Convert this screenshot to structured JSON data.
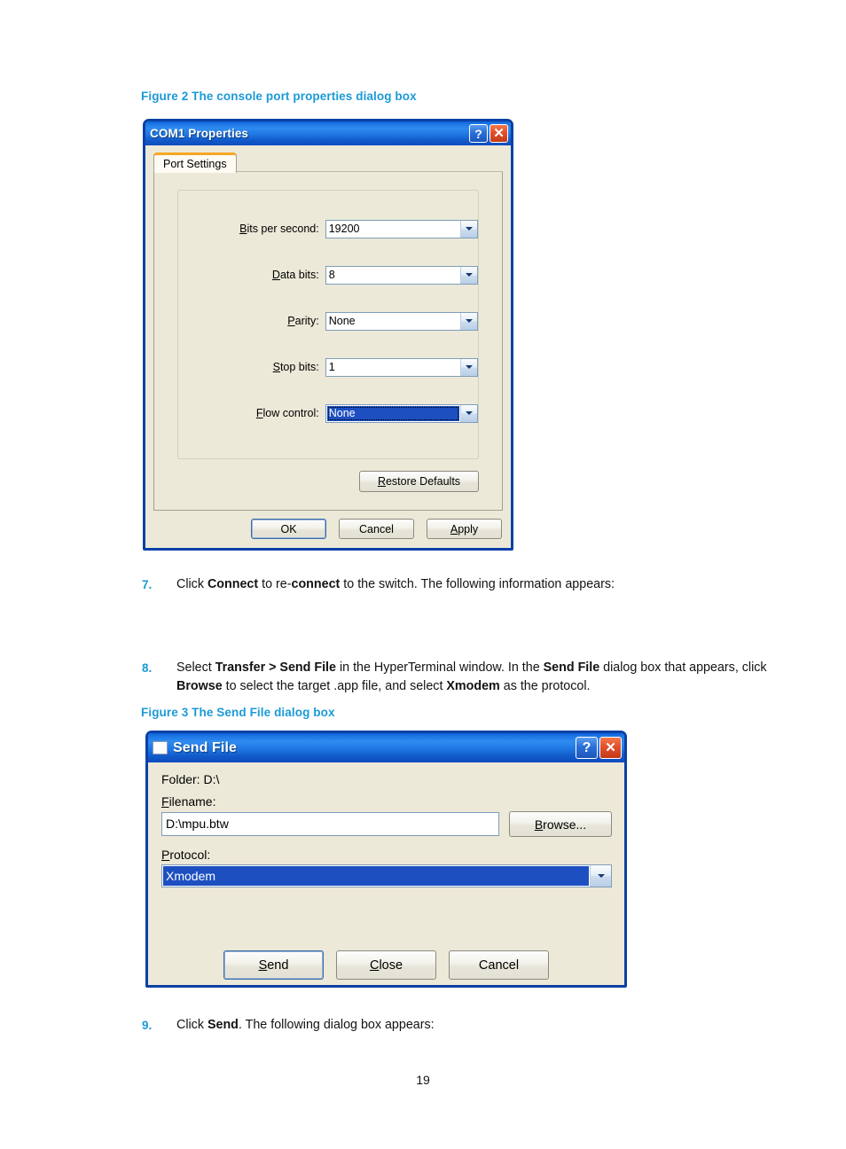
{
  "figure2": {
    "caption": "Figure 2 The console port properties dialog box",
    "dialog": {
      "title": "COM1 Properties",
      "help_button": "?",
      "close_button": "✕",
      "tab": "Port Settings",
      "fields": [
        {
          "label_pre": "B",
          "label_accel": "B",
          "label": "Bits per second:",
          "value": "19200"
        },
        {
          "label": "Data bits:",
          "value": "8"
        },
        {
          "label": "Parity:",
          "value": "None"
        },
        {
          "label": "Stop bits:",
          "value": "1"
        },
        {
          "label": "Flow control:",
          "value": "None"
        }
      ],
      "restore_defaults": "Restore Defaults",
      "ok": "OK",
      "cancel": "Cancel",
      "apply": "Apply"
    }
  },
  "step7": {
    "number": "7.",
    "text": "Click Connect to re-connect to the switch. The following information appears:"
  },
  "step8": {
    "number": "8.",
    "line1": "Select Transfer > Send File in the HyperTerminal window. In the Send File dialog box that appears,",
    "line2": "click Browse to select the target .app file, and select Xmodem as the protocol."
  },
  "figure3": {
    "caption": "Figure 3 The Send File dialog box",
    "dialog": {
      "title": "Send File",
      "help_button": "?",
      "close_button": "✕",
      "folder": "Folder:  D:\\",
      "filename_label": "Filename:",
      "filename_value": "D:\\mpu.btw",
      "browse": "Browse...",
      "protocol_label": "Protocol:",
      "protocol_value": "Xmodem",
      "send": "Send",
      "close": "Close",
      "cancel": "Cancel"
    }
  },
  "step9": {
    "number": "9.",
    "text": "Click Send. The following dialog box appears:"
  },
  "footer": {
    "page": "19"
  },
  "colors": {
    "accent": "#1b9ad6",
    "title_blue": "#0b41a5",
    "dialog_face": "#ece9d8",
    "selection": "#1d4fc0",
    "tab_accent": "#f5a724"
  }
}
